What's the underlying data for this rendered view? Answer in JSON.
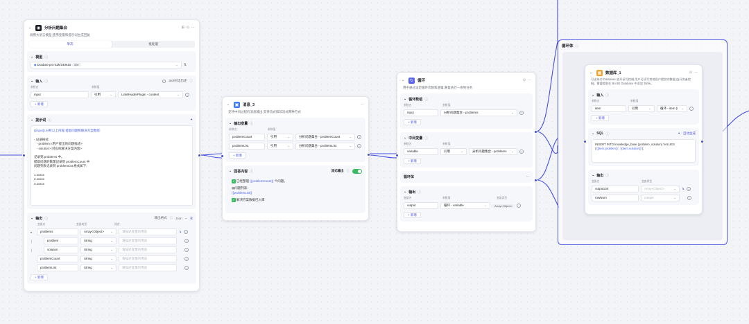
{
  "node_llm": {
    "title": "分析问题集合",
    "desc": "调用大语言模型,使用变量和提示词生成回复",
    "tabs": [
      "单次",
      "批处理"
    ],
    "model_label": "模型",
    "model_value": "Doubao-pro-32k/240615",
    "model_badge": "32K",
    "input_label": "输入",
    "input_toggle": "Skill对话历史",
    "col_name": "参数名",
    "col_value": "参数值",
    "input_name": "input",
    "input_ref": "引用",
    "input_value": "LinkReaderPlugin - content",
    "add": "新增",
    "prompt_label": "提示词",
    "prompt_lines": [
      "{{input}},分析以上内容,提取问题和解决方案数组:",
      "",
      "- 记录格式:",
      "   - problem:<用户提出的问题描述>",
      "   - solution:<对应的解决方案内容>",
      "",
      "记录到 problems 中。",
      "提取问题的数量记录到 problemCount 中",
      "问题列表记录到 problemList,格式如下:",
      "",
      "1.xxxxx",
      "2.xxxxx",
      "3.xxxxx"
    ],
    "output_label": "输出",
    "output_format_label": "输出格式",
    "output_format": "Json",
    "col_var": "变量名",
    "col_type": "变量类型",
    "col_desc": "描述",
    "desc_placeholder": "请描述变量的用途",
    "outputs": [
      {
        "name": "problems",
        "type": "Array<Object>",
        "indent": 0
      },
      {
        "name": "problem",
        "type": "String",
        "indent": 1
      },
      {
        "name": "solution",
        "type": "String",
        "indent": 1
      },
      {
        "name": "problemCount",
        "type": "String",
        "indent": 0
      },
      {
        "name": "problemList",
        "type": "String",
        "indent": 0
      }
    ]
  },
  "node_message": {
    "title": "消息_3",
    "desc": "支持中间过程的消息输出,支持流式和非流式两种方式",
    "out_var_label": "输出变量",
    "col_name": "参数名",
    "col_value": "参数值",
    "vars": [
      {
        "name": "problemCount",
        "ref": "引用",
        "value": "分析问题集合 - problemCount"
      },
      {
        "name": "problemList",
        "ref": "引用",
        "value": "分析问题集合 - problemList"
      }
    ],
    "add": "新增",
    "reply_label": "回答内容",
    "stream_label": "流式输出",
    "reply_line1_a": "已经整理 ",
    "reply_line1_var": "{{problemCount}}",
    "reply_line1_b": " 个问题。",
    "reply_line2": "问题列表:",
    "reply_line3": "{{problemList}}",
    "reply_line4": "解决方案数据已入库"
  },
  "node_loop": {
    "title": "循环",
    "desc": "用于通过设定循环次数和逻辑,重复执行一系列任务",
    "loop_data_label": "循环数组",
    "col_name": "参数名",
    "col_value": "参数值",
    "loop_input_name": "input",
    "loop_input_value": "分析问题集合 - problems",
    "add": "新增",
    "mid_label": "中间变量",
    "mid_name": "variable",
    "mid_ref": "引用",
    "mid_value": "分析问题集合 - problems",
    "body_label": "循环体",
    "output_label": "输出",
    "col_var": "变量名",
    "col_type": "变量类型",
    "out_name": "output",
    "out_value": "循环 - variable",
    "out_type": "Array<Object>"
  },
  "container": {
    "title": "循环体"
  },
  "node_db": {
    "title": "数据库_1",
    "desc": "可支持对 Database 放开读写控制,用户可读写其他用户提交的数据,由开发者控制。需要提前在 Bot 的 Database 中添加 Table。",
    "input_label": "输入",
    "col_name": "参数名",
    "col_value": "参数值",
    "item_name": "item",
    "item_ref": "引用",
    "item_value": "循环 - item (i",
    "add": "新增",
    "sql_label": "SQL",
    "sql_auto": "自动生成",
    "sql_text_a": "INSERT INTO knowledge_base (problem, solution) VALUES (",
    "sql_var1": "'{{item.problem}}'",
    "sql_sep": ", ",
    "sql_var2": "'{{item.solution}}'",
    "sql_end": ");",
    "output_label": "输出",
    "col_var": "变量名",
    "col_type": "变量类型",
    "outputs": [
      "outputList",
      "rowNum"
    ],
    "output_types": [
      "Array<Object>",
      "Integer"
    ]
  }
}
